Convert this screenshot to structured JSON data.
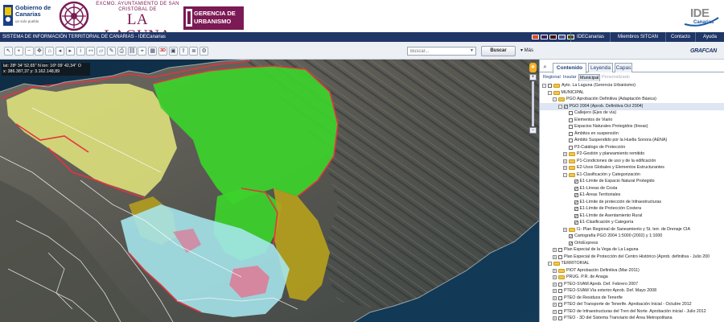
{
  "header": {
    "gobierno_name": "Gobierno de Canarias",
    "gobierno_slogan": "un solo pueblo",
    "ayto_top": "EXCMO. AYUNTAMIENTO DE SAN CRISTÓBAL DE",
    "ayto_name": "LA LAGUNA",
    "gerencia_line1": "GERENCIA DE",
    "gerencia_line2": "URBANISMO",
    "ide_main": "IDE",
    "ide_sub": "Canarias"
  },
  "navbar": {
    "title": "SISTEMA DE INFORMACIÓN TERRITORIAL DE CANARIAS - IDECanarias",
    "links": [
      "IDECanarias",
      "Miembros SITCAN",
      "Contacto",
      "Ayuda"
    ],
    "flag_colors": [
      [
        "#c60b1e",
        "#ffc400"
      ],
      [
        "#012169",
        "#c8102e"
      ],
      [
        "#000000",
        "#dd0000"
      ],
      [
        "#0055a4",
        "#ef4135"
      ],
      [
        "#006600",
        "#ff0000"
      ]
    ]
  },
  "toolbar": {
    "tools": [
      "arrow-icon",
      "zoom-in-icon",
      "zoom-out-icon",
      "pan-icon",
      "zoom-full-icon",
      "previous-view-icon",
      "next-view-icon",
      "info-icon",
      "measure-distance-icon",
      "measure-area-icon",
      "draw-icon",
      "print-icon",
      "link-icon",
      "coordinates-icon",
      "grid-icon",
      "3d-icon",
      "snapshot-icon",
      "export-icon",
      "layers-icon",
      "settings-icon"
    ],
    "tool_glyphs": [
      "↖",
      "+",
      "−",
      "✥",
      "⌂",
      "◂",
      "▸",
      "i",
      "⇿",
      "▱",
      "✎",
      "⎙",
      "⛓",
      "⌖",
      "▦",
      "3D",
      "▣",
      "⇪",
      "≣",
      "⚙"
    ],
    "search_placeholder": "Buscar...",
    "search_button": "Buscar",
    "more_button": "Más",
    "brand": "GRAFCAN"
  },
  "map": {
    "coords_line1": "lat: 28º 34' 52,65'' N lon: 16º 09' 42,34'' O",
    "coords_line2": "x: 386.387,37 y: 3.162.148,89",
    "colors": {
      "green": "#3cd22b",
      "yellow": "#e4e77c",
      "olive": "#b7a11c",
      "cyan": "#a6e7ee",
      "red": "#e5333f",
      "pink": "#e86c8c"
    }
  },
  "panel": {
    "tabs": [
      "Contenido",
      "Leyenda",
      "Capas"
    ],
    "subtabs": [
      "Regional",
      "Insular",
      "Municipal",
      "Personalizado"
    ],
    "tree": [
      {
        "level": 0,
        "expand": "-",
        "check": false,
        "folder": true,
        "label": "Ayto. La Laguna (Gerencia Urbanismo)"
      },
      {
        "level": 1,
        "expand": "-",
        "check": null,
        "folder": true,
        "label": "MUNICIPAL"
      },
      {
        "level": 2,
        "expand": "-",
        "check": null,
        "folder": true,
        "label": "PGO Aprobación Definitiva (Adaptación Básica)"
      },
      {
        "level": 3,
        "expand": "-",
        "check": true,
        "folder": false,
        "label": "PGO 2004 (Aprob. Definitiva Oct 2004)",
        "selected": true
      },
      {
        "level": 4,
        "expand": "",
        "check": false,
        "folder": false,
        "label": "Callejero (Ejes de vía)"
      },
      {
        "level": 4,
        "expand": "",
        "check": false,
        "folder": false,
        "label": "Elementos de Viario"
      },
      {
        "level": 4,
        "expand": "",
        "check": false,
        "folder": false,
        "label": "Espacios Naturales Protegidos (líneas)"
      },
      {
        "level": 4,
        "expand": "",
        "check": false,
        "folder": false,
        "label": "Ámbitos en suspensión"
      },
      {
        "level": 4,
        "expand": "",
        "check": false,
        "folder": false,
        "label": "Ámbito Suspendido por la Huella Sonora (AENA)"
      },
      {
        "level": 4,
        "expand": "",
        "check": false,
        "folder": false,
        "label": "P3-Catálogo de Protección"
      },
      {
        "level": 4,
        "expand": "+",
        "check": null,
        "folder": true,
        "label": "P2-Gestión y planeamiento remitido"
      },
      {
        "level": 4,
        "expand": "+",
        "check": null,
        "folder": true,
        "label": "P1-Condiciones de uso y de la edificación"
      },
      {
        "level": 4,
        "expand": "+",
        "check": null,
        "folder": true,
        "label": "E2-Usos Globales y Elementos Estructurantes"
      },
      {
        "level": 4,
        "expand": "-",
        "check": null,
        "folder": true,
        "label": "E1-Clasificación y Categorización"
      },
      {
        "level": 5,
        "expand": "",
        "check": true,
        "folder": false,
        "label": "E1-Límite de Espacio Natural Protegido"
      },
      {
        "level": 5,
        "expand": "",
        "check": true,
        "folder": false,
        "label": "E1-Líneas de Costa"
      },
      {
        "level": 5,
        "expand": "",
        "check": true,
        "folder": false,
        "label": "E1-Áreas Territoriales"
      },
      {
        "level": 5,
        "expand": "",
        "check": true,
        "folder": false,
        "label": "E1-Límite de protección de Infraestructuras"
      },
      {
        "level": 5,
        "expand": "",
        "check": true,
        "folder": false,
        "label": "E1-Límite de Protección Costera"
      },
      {
        "level": 5,
        "expand": "",
        "check": true,
        "folder": false,
        "label": "E1-Límite de Asentamiento Rural"
      },
      {
        "level": 5,
        "expand": "",
        "check": true,
        "folder": false,
        "label": "E1-Clasificación y Categoría"
      },
      {
        "level": 4,
        "expand": "+",
        "check": null,
        "folder": true,
        "label": "I1- Plan Regional de Saneamiento y St. terr. de Drenaje CIA"
      },
      {
        "level": 4,
        "expand": "",
        "check": true,
        "folder": false,
        "label": "Cartografía PGO 2004 1:5000 (2002) y 1:1000"
      },
      {
        "level": 4,
        "expand": "",
        "check": true,
        "folder": false,
        "label": "OrtoExpress"
      },
      {
        "level": 2,
        "expand": "+",
        "check": false,
        "folder": false,
        "label": "Plan Especial de la Vega de La Laguna"
      },
      {
        "level": 2,
        "expand": "+",
        "check": false,
        "folder": false,
        "label": "Plan Especial de Protección del Centro Histórico (Aprob. definitiva - Julio 200"
      },
      {
        "level": 1,
        "expand": "-",
        "check": null,
        "folder": true,
        "label": "TERRITORIAL"
      },
      {
        "level": 2,
        "expand": "+",
        "check": null,
        "folder": true,
        "label": "PIOT Aprobación Definitiva (Mar-2011)"
      },
      {
        "level": 2,
        "expand": "+",
        "check": null,
        "folder": true,
        "label": "PRUG. P.R. de Anaga"
      },
      {
        "level": 2,
        "expand": "+",
        "check": false,
        "folder": false,
        "label": "PTEO-SVAM Aprob. Def. Febrero 2007"
      },
      {
        "level": 2,
        "expand": "+",
        "check": false,
        "folder": false,
        "label": "PTEO-SVAM Vía exterior Aprob. Def. Mayo 2008"
      },
      {
        "level": 2,
        "expand": "+",
        "check": false,
        "folder": false,
        "label": "PTEO de Residuos de Tenerife"
      },
      {
        "level": 2,
        "expand": "+",
        "check": false,
        "folder": false,
        "label": "PTEO del Transporte de Tenerife. Aprobación Inicial - Octubre 2012"
      },
      {
        "level": 2,
        "expand": "+",
        "check": false,
        "folder": false,
        "label": "PTEO de Infraestructuras del Tren del Norte. Aprobación inicial - Julio 2012"
      },
      {
        "level": 2,
        "expand": "+",
        "check": false,
        "folder": false,
        "label": "PTEO - 3D del Sistema Tranviario del Área Metropolitana"
      }
    ]
  }
}
